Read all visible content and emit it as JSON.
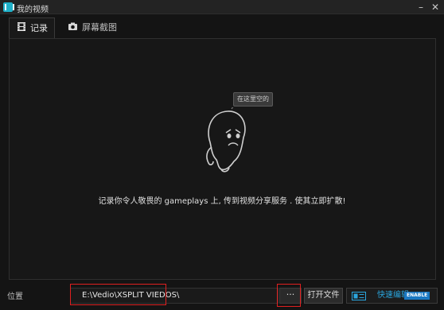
{
  "window": {
    "title": "我的视频"
  },
  "tabs": [
    {
      "label": "记录",
      "icon": "film-icon",
      "active": true
    },
    {
      "label": "屏幕截图",
      "icon": "camera-icon",
      "active": false
    }
  ],
  "empty_state": {
    "bubble_text": "在这里空的",
    "message": "记录你令人敬畏的 gameplays 上, 传到视频分享服务 . 使其立即扩散!"
  },
  "footer": {
    "location_label": "位置",
    "path_value": "E:\\Vedio\\XSPLIT VIEDOS\\",
    "browse_label": "···",
    "open_file_label": "打开文件",
    "quick_edit_label": "快速编辑",
    "enable_badge": "ENABLE"
  },
  "colors": {
    "accent": "#2aa6de",
    "highlight": "#e02020",
    "background": "#141414"
  }
}
